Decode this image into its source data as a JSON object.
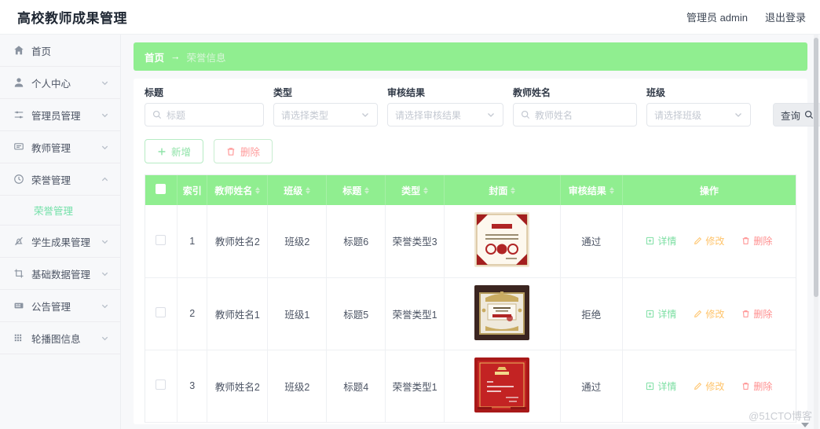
{
  "header": {
    "brand": "高校教师成果管理",
    "user": "管理员 admin",
    "logout": "退出登录"
  },
  "sidebar": {
    "items": [
      {
        "label": "首页",
        "icon": "home-icon",
        "expandable": false
      },
      {
        "label": "个人中心",
        "icon": "user-icon",
        "expandable": true
      },
      {
        "label": "管理员管理",
        "icon": "sliders-icon",
        "expandable": true
      },
      {
        "label": "教师管理",
        "icon": "message-icon",
        "expandable": true
      },
      {
        "label": "荣誉管理",
        "icon": "clock-icon",
        "expandable": true,
        "expanded": true
      },
      {
        "label": "学生成果管理",
        "icon": "bell-off-icon",
        "expandable": true
      },
      {
        "label": "基础数据管理",
        "icon": "crop-icon",
        "expandable": true
      },
      {
        "label": "公告管理",
        "icon": "announcement-icon",
        "expandable": true
      },
      {
        "label": "轮播图信息",
        "icon": "grid-icon",
        "expandable": true
      }
    ],
    "submenu": {
      "label": "荣誉管理"
    }
  },
  "breadcrumb": {
    "home": "首页",
    "separator": "→",
    "current": "荣誉信息"
  },
  "filters": {
    "fields": [
      {
        "label": "标题",
        "placeholder": "标题",
        "type": "search"
      },
      {
        "label": "类型",
        "placeholder": "请选择类型",
        "type": "select"
      },
      {
        "label": "审核结果",
        "placeholder": "请选择审核结果",
        "type": "select"
      },
      {
        "label": "教师姓名",
        "placeholder": "教师姓名",
        "type": "search"
      },
      {
        "label": "班级",
        "placeholder": "请选择班级",
        "type": "select"
      }
    ],
    "search_button": "查询"
  },
  "toolbar": {
    "add_label": "新增",
    "delete_label": "删除"
  },
  "table": {
    "columns": [
      {
        "key": "checkbox",
        "label": "",
        "sortable": false
      },
      {
        "key": "index",
        "label": "索引",
        "sortable": false
      },
      {
        "key": "teacher",
        "label": "教师姓名",
        "sortable": true
      },
      {
        "key": "class",
        "label": "班级",
        "sortable": true
      },
      {
        "key": "title",
        "label": "标题",
        "sortable": true
      },
      {
        "key": "type",
        "label": "类型",
        "sortable": true
      },
      {
        "key": "cover",
        "label": "封面",
        "sortable": true
      },
      {
        "key": "review",
        "label": "审核结果",
        "sortable": true
      },
      {
        "key": "ops",
        "label": "操作",
        "sortable": false
      }
    ],
    "rows": [
      {
        "index": "1",
        "teacher": "教师姓名2",
        "class": "班级2",
        "title": "标题6",
        "type": "荣誉类型3",
        "cover": "honor-certificate-beige",
        "review": "通过"
      },
      {
        "index": "2",
        "teacher": "教师姓名1",
        "class": "班级1",
        "title": "标题5",
        "type": "荣誉类型1",
        "cover": "award-plaque-brown",
        "review": "拒绝"
      },
      {
        "index": "3",
        "teacher": "教师姓名2",
        "class": "班级2",
        "title": "标题4",
        "type": "荣誉类型1",
        "cover": "honor-certificate-red",
        "review": "通过"
      }
    ],
    "ops": {
      "detail": "详情",
      "edit": "修改",
      "delete": "删除"
    }
  },
  "watermark": "@51CTO博客",
  "colors": {
    "accent_green": "#90ee90",
    "submenu_green": "#74e0a9",
    "detail_green": "#7ddfa3",
    "edit_orange": "#ffc46b",
    "delete_red": "#ff8f8f",
    "text_primary": "#4c5464"
  }
}
